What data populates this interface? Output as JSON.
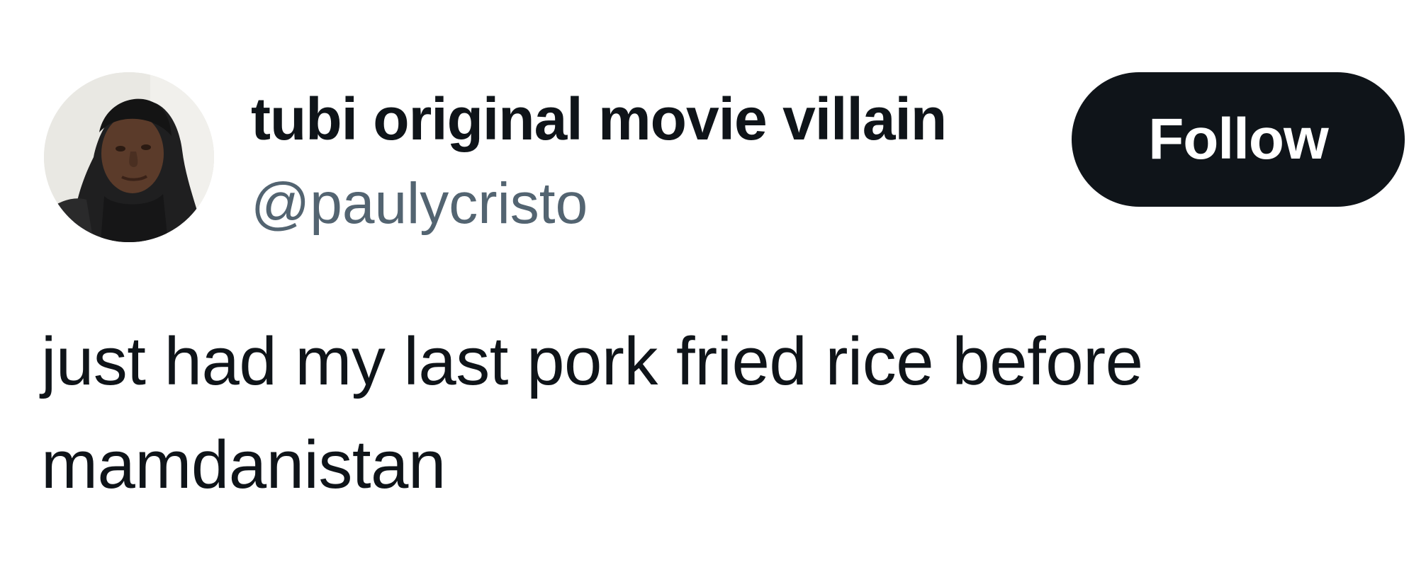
{
  "tweet": {
    "author": {
      "display_name": "tubi original movie villain",
      "handle": "@paulycristo",
      "avatar_icon": "profile-photo"
    },
    "follow_button": {
      "label": "Follow",
      "background": "#0f1419",
      "text_color": "#ffffff"
    },
    "text_lines": [
      "just had my last pork fried rice before",
      "mamdanistan"
    ],
    "colors": {
      "primary_text": "#0f1419",
      "secondary_text": "#536471",
      "background": "#ffffff"
    }
  }
}
